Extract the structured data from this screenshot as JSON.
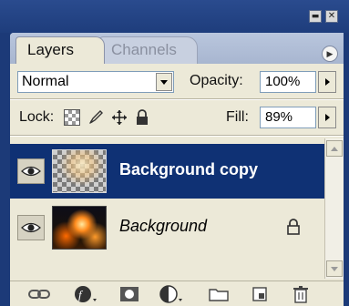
{
  "tabs": [
    {
      "label": "Layers"
    },
    {
      "label": "Channels"
    }
  ],
  "window_controls": {
    "minimize": "▬",
    "close": "✕"
  },
  "blend_mode": {
    "value": "Normal"
  },
  "opacity": {
    "label": "Opacity:",
    "value": "100%"
  },
  "lock": {
    "label": "Lock:"
  },
  "fill": {
    "label": "Fill:",
    "value": "89%"
  },
  "layers": [
    {
      "name": "Background copy",
      "visible": true,
      "selected": true,
      "locked": false
    },
    {
      "name": "Background",
      "visible": true,
      "selected": false,
      "locked": true
    }
  ],
  "toolbar_icons": [
    "link-layers-icon",
    "layer-style-icon",
    "layer-mask-icon",
    "adjustment-layer-icon",
    "new-group-icon",
    "new-layer-icon",
    "trash-icon"
  ],
  "colors": {
    "chrome_blue": "#1c3a78",
    "panel_bg": "#ece9d8",
    "selected_row": "#0f3174"
  }
}
